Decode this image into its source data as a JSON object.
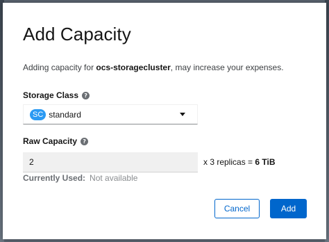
{
  "modal": {
    "title": "Add Capacity",
    "description_prefix": "Adding capacity for ",
    "cluster_name": "ocs-storagecluster",
    "description_suffix": ", may increase your expenses."
  },
  "storage_class": {
    "label": "Storage Class",
    "help_icon": "question-circle-icon",
    "badge": "SC",
    "selected_value": "standard"
  },
  "raw_capacity": {
    "label": "Raw Capacity",
    "help_icon": "question-circle-icon",
    "value": "2",
    "replicas_text": "x 3 replicas = ",
    "total": "6 TiB"
  },
  "current_used": {
    "label": "Currently Used:",
    "value": "Not available"
  },
  "buttons": {
    "cancel_label": "Cancel",
    "add_label": "Add"
  },
  "colors": {
    "primary": "#0066cc",
    "badge": "#2b9af3",
    "input_bg": "#f0f0f0"
  }
}
